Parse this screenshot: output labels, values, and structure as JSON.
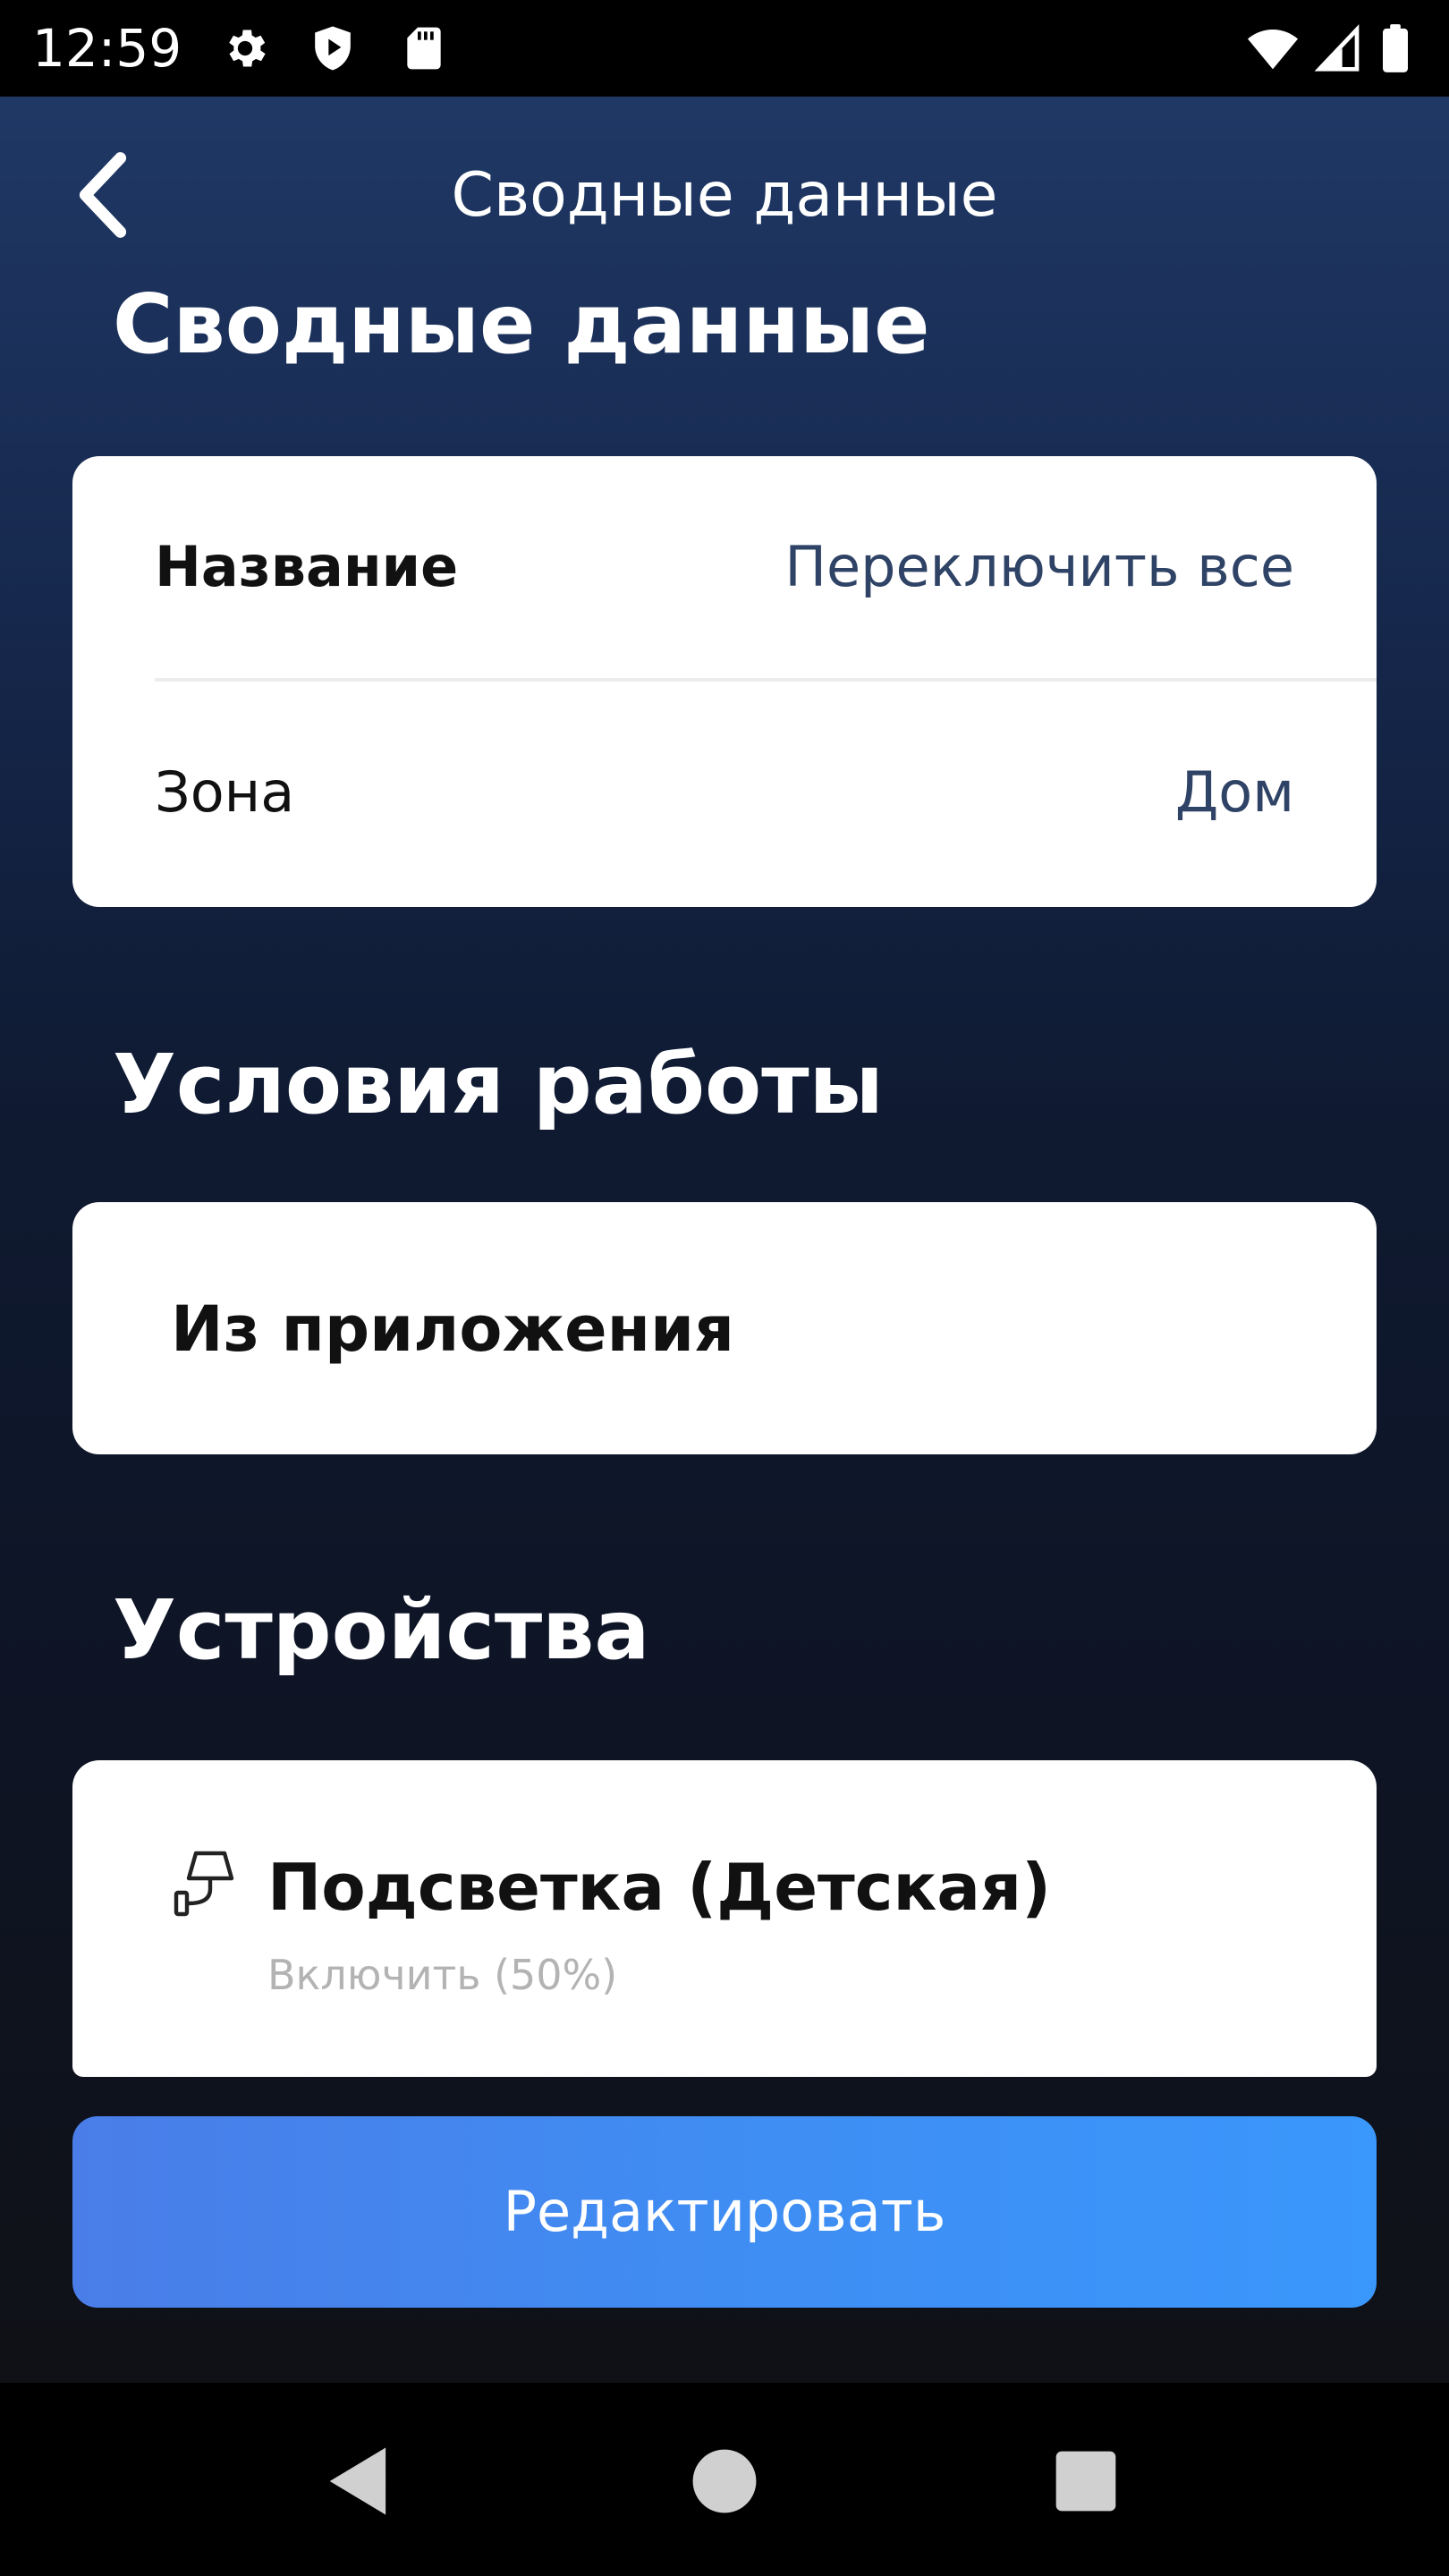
{
  "status_bar": {
    "time": "12:59",
    "icons": [
      "gear-icon",
      "shield-play-icon",
      "sd-card-icon",
      "wifi-icon",
      "signal-icon",
      "battery-icon"
    ]
  },
  "toolbar": {
    "title": "Сводные данные",
    "back_icon": "chevron-left-icon"
  },
  "summary": {
    "title": "Сводные данные",
    "rows": [
      {
        "label": "Название",
        "value": "Переключить все"
      },
      {
        "label": "Зона",
        "value": "Дом"
      }
    ]
  },
  "conditions": {
    "title": "Условия работы",
    "item": "Из приложения"
  },
  "devices": {
    "title": "Устройства",
    "items": [
      {
        "icon": "wall-lamp-icon",
        "name": "Подсветка (Детская)",
        "action": "Включить (50%)"
      }
    ]
  },
  "edit_button": {
    "label": "Редактировать"
  },
  "nav_bar": {
    "icons": [
      "back-triangle-icon",
      "home-circle-icon",
      "recents-square-icon"
    ]
  },
  "colors": {
    "background_top": "#1f3865",
    "background_bottom": "#0f1116",
    "card": "#ffffff",
    "value_text": "#2f4366",
    "button_start": "#4a7de8",
    "button_end": "#3a97fb",
    "muted_text": "#b3b3b3"
  }
}
